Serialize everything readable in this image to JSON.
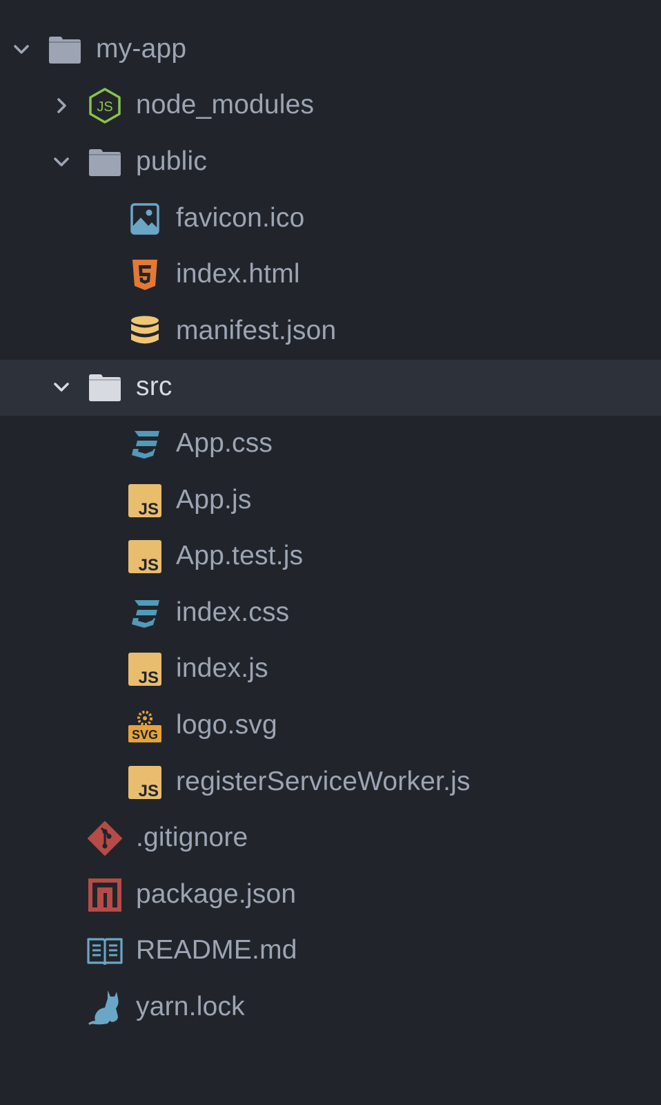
{
  "colors": {
    "background": "#21252b",
    "selected_row": "#2c313a",
    "text": "#9da5b4",
    "text_selected": "#d7dae0",
    "folder": "#9da5b4",
    "node_green": "#8bc34a",
    "image_blue": "#6aa7c7",
    "html_orange": "#e37933",
    "json_yellow": "#f0c674",
    "css_blue": "#519aba",
    "js_yellow": "#e8bd6e",
    "svg_orange": "#e5a33b",
    "git_red": "#b74b45",
    "npm_red": "#b74b45",
    "readme_blue": "#6aa7c7",
    "yarn_blue": "#6aa7c7"
  },
  "tree": {
    "items": [
      {
        "label": "my-app",
        "depth": 0,
        "kind": "folder",
        "expanded": true,
        "icon": "folder-open-icon"
      },
      {
        "label": "node_modules",
        "depth": 1,
        "kind": "folder",
        "expanded": false,
        "icon": "nodejs-icon"
      },
      {
        "label": "public",
        "depth": 1,
        "kind": "folder",
        "expanded": true,
        "icon": "folder-open-icon"
      },
      {
        "label": "favicon.ico",
        "depth": 2,
        "kind": "file",
        "icon": "image-icon"
      },
      {
        "label": "index.html",
        "depth": 2,
        "kind": "file",
        "icon": "html5-icon"
      },
      {
        "label": "manifest.json",
        "depth": 2,
        "kind": "file",
        "icon": "database-icon"
      },
      {
        "label": "src",
        "depth": 1,
        "kind": "folder",
        "expanded": true,
        "selected": true,
        "icon": "folder-open-icon"
      },
      {
        "label": "App.css",
        "depth": 2,
        "kind": "file",
        "icon": "css3-icon"
      },
      {
        "label": "App.js",
        "depth": 2,
        "kind": "file",
        "icon": "javascript-icon"
      },
      {
        "label": "App.test.js",
        "depth": 2,
        "kind": "file",
        "icon": "javascript-icon"
      },
      {
        "label": "index.css",
        "depth": 2,
        "kind": "file",
        "icon": "css3-icon"
      },
      {
        "label": "index.js",
        "depth": 2,
        "kind": "file",
        "icon": "javascript-icon"
      },
      {
        "label": "logo.svg",
        "depth": 2,
        "kind": "file",
        "icon": "svg-icon"
      },
      {
        "label": "registerServiceWorker.js",
        "depth": 2,
        "kind": "file",
        "icon": "javascript-icon"
      },
      {
        "label": ".gitignore",
        "depth": 1,
        "kind": "file",
        "icon": "git-icon"
      },
      {
        "label": "package.json",
        "depth": 1,
        "kind": "file",
        "icon": "npm-icon"
      },
      {
        "label": "README.md",
        "depth": 1,
        "kind": "file",
        "icon": "book-icon"
      },
      {
        "label": "yarn.lock",
        "depth": 1,
        "kind": "file",
        "icon": "yarn-cat-icon"
      }
    ]
  }
}
